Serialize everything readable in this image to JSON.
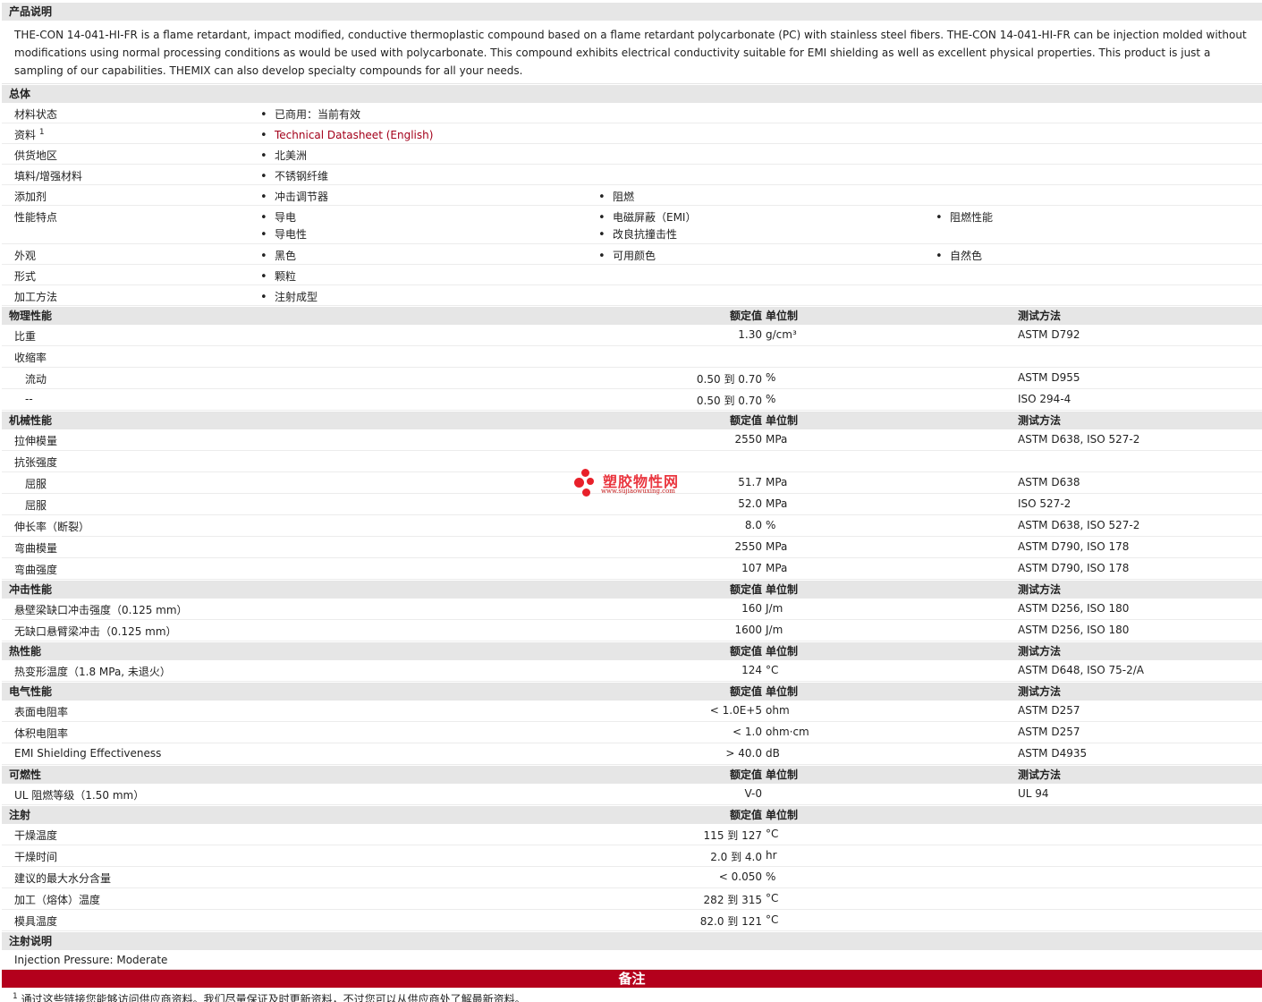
{
  "desc_section": {
    "title": "产品说明",
    "text": "THE-CON 14-041-HI-FR is a flame retardant, impact modified, conductive thermoplastic compound based on a flame retardant polycarbonate (PC) with stainless steel fibers. THE-CON 14-041-HI-FR can be injection molded without modifications using normal processing conditions as would be used with polycarbonate. This compound exhibits electrical conductivity suitable for EMI shielding as well as excellent physical properties. This product is just a sampling of our capabilities. THEMIX can also develop specialty compounds for all your needs."
  },
  "general": {
    "title": "总体",
    "status_label": "材料状态",
    "status": "已商用：当前有效",
    "docs_label": "资料",
    "docs_sup": "1",
    "docs_link": "Technical Datasheet (English)",
    "region_label": "供货地区",
    "region": "北美洲",
    "filler_label": "填料/增强材料",
    "filler": "不锈钢纤维",
    "additive_label": "添加剂",
    "additive_1": "冲击调节器",
    "additive_2": "阻燃",
    "feature_label": "性能特点",
    "feature_1": "导电",
    "feature_2": "导电性",
    "feature_3": "电磁屏蔽（EMI）",
    "feature_4": "改良抗撞击性",
    "feature_5": "阻燃性能",
    "appearance_label": "外观",
    "appearance_1": "黑色",
    "appearance_2": "可用颜色",
    "appearance_3": "自然色",
    "form_label": "形式",
    "form": "颗粒",
    "process_label": "加工方法",
    "process": "注射成型"
  },
  "headers": {
    "value": "额定值",
    "unit": "单位制",
    "test": "测试方法"
  },
  "physical": {
    "title": "物理性能",
    "rows": [
      {
        "label": "比重",
        "value": "1.30",
        "unit": "g/cm³",
        "test": "ASTM D792"
      },
      {
        "label": "收缩率",
        "value": "",
        "unit": "",
        "test": ""
      },
      {
        "label": "流动",
        "value": "0.50 到  0.70",
        "unit": "%",
        "test": "ASTM D955"
      },
      {
        "label": "--",
        "value": "0.50 到  0.70",
        "unit": "%",
        "test": "ISO 294-4"
      }
    ]
  },
  "mechanical": {
    "title": "机械性能",
    "rows": [
      {
        "label": "拉伸模量",
        "value": "2550",
        "unit": "MPa",
        "test": "ASTM D638, ISO 527-2"
      },
      {
        "label": "抗张强度",
        "value": "",
        "unit": "",
        "test": ""
      },
      {
        "label": "屈服",
        "value": "51.7",
        "unit": "MPa",
        "test": "ASTM D638"
      },
      {
        "label": "屈服",
        "value": "52.0",
        "unit": "MPa",
        "test": "ISO 527-2"
      },
      {
        "label": "伸长率（断裂）",
        "value": "8.0",
        "unit": "%",
        "test": "ASTM D638, ISO 527-2"
      },
      {
        "label": "弯曲模量",
        "value": "2550",
        "unit": "MPa",
        "test": "ASTM D790, ISO 178"
      },
      {
        "label": "弯曲强度",
        "value": "107",
        "unit": "MPa",
        "test": "ASTM D790, ISO 178"
      }
    ]
  },
  "impact": {
    "title": "冲击性能",
    "rows": [
      {
        "label": "悬壁梁缺口冲击强度（0.125 mm）",
        "value": "160",
        "unit": "J/m",
        "test": "ASTM D256, ISO 180"
      },
      {
        "label": "无缺口悬臂梁冲击（0.125 mm）",
        "value": "1600",
        "unit": "J/m",
        "test": "ASTM D256, ISO 180"
      }
    ]
  },
  "thermal": {
    "title": "热性能",
    "rows": [
      {
        "label": "热变形温度（1.8 MPa, 未退火）",
        "value": "124",
        "unit": "°C",
        "test": "ASTM D648, ISO 75-2/A"
      }
    ]
  },
  "electrical": {
    "title": "电气性能",
    "rows": [
      {
        "label": "表面电阻率",
        "value": "< 1.0E+5",
        "unit": "ohm",
        "test": "ASTM D257"
      },
      {
        "label": "体积电阻率",
        "value": "< 1.0",
        "unit": "ohm·cm",
        "test": "ASTM D257"
      },
      {
        "label": "EMI Shielding Effectiveness",
        "value": "> 40.0",
        "unit": "dB",
        "test": "ASTM D4935"
      }
    ]
  },
  "flammability": {
    "title": "可燃性",
    "rows": [
      {
        "label": "UL 阻燃等级（1.50 mm）",
        "value": "V-0",
        "unit": "",
        "test": "UL 94"
      }
    ]
  },
  "injection": {
    "title": "注射",
    "rows": [
      {
        "label": "干燥温度",
        "value": "115 到  127",
        "unit": "°C",
        "test": ""
      },
      {
        "label": "干燥时间",
        "value": "2.0 到  4.0",
        "unit": "hr",
        "test": ""
      },
      {
        "label": "建议的最大水分含量",
        "value": "< 0.050",
        "unit": "%",
        "test": ""
      },
      {
        "label": "加工（熔体）温度",
        "value": "282 到  315",
        "unit": "°C",
        "test": ""
      },
      {
        "label": "模具温度",
        "value": "82.0 到  121",
        "unit": "°C",
        "test": ""
      }
    ]
  },
  "injection_notes": {
    "title": "注射说明",
    "text": "Injection Pressure: Moderate"
  },
  "notes": {
    "title": "备注",
    "footnote_num": "1",
    "footnote": "通过这些链接您能够访问供应商资料。我们尽量保证及时更新资料，不过您可以从供应商处了解最新资料。"
  },
  "watermark": {
    "cn": "塑胶物性网",
    "url": "www.sujiaowuxing.com"
  },
  "colors": {
    "section_bg": "#e6e6e6",
    "accent": "#b4001c",
    "link": "#a3001a"
  }
}
